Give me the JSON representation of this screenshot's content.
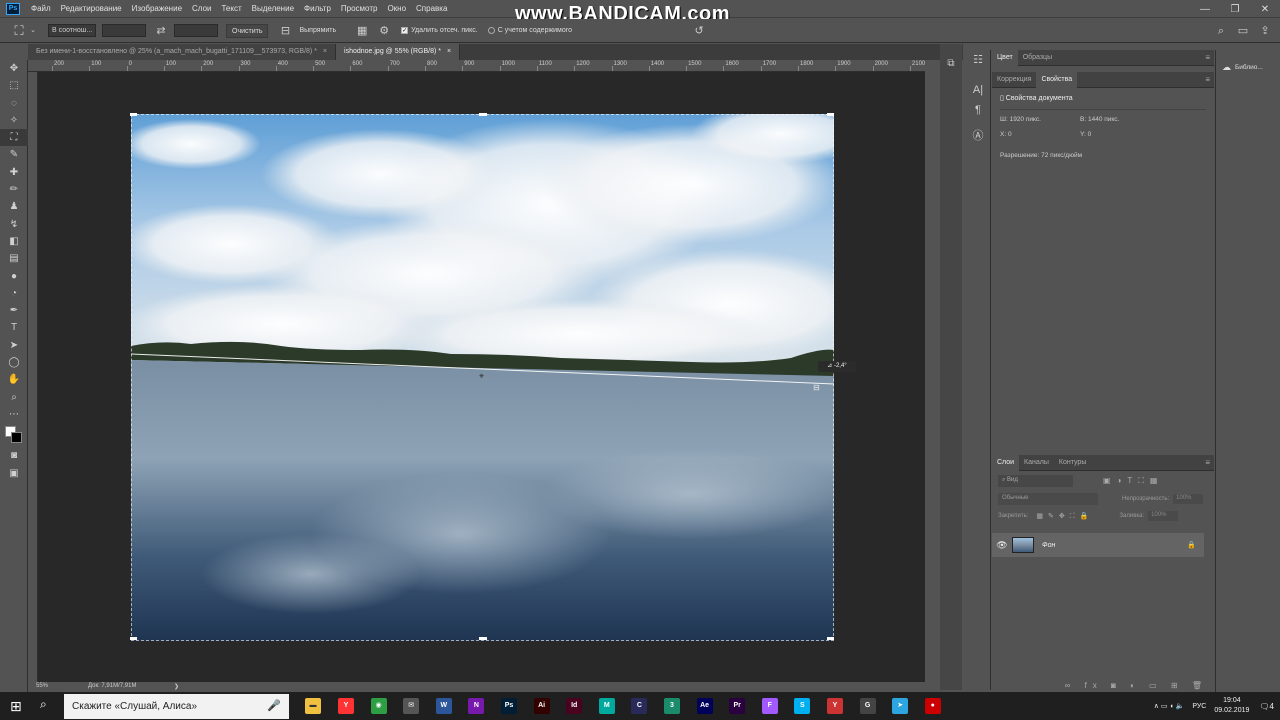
{
  "app": {
    "icon_label": "Ps",
    "menu": [
      "Файл",
      "Редактирование",
      "Изображение",
      "Слои",
      "Текст",
      "Выделение",
      "Фильтр",
      "Просмотр",
      "Окно",
      "Справка"
    ],
    "window_controls": [
      "—",
      "❐",
      "✕"
    ],
    "watermark": "www.BANDICAM.com"
  },
  "options_bar": {
    "ratio_select": "В соотнош...",
    "clear_button": "Очистить",
    "straighten_button": "Выпрямить",
    "delete_cropped_label": "Удалить отсеч. пикс.",
    "content_aware_label": "С учетом содержимого"
  },
  "tabs": [
    {
      "label": "Без имени-1-восстановлено @ 25% (a_mach_mach_bugatti_171109__573973, RGB/8) *",
      "close": "×"
    },
    {
      "label": "ishodnoe.jpg @ 55% (RGB/8) *",
      "close": "×"
    }
  ],
  "ruler_labels": [
    "200",
    "100",
    "0",
    "100",
    "200",
    "300",
    "400",
    "500",
    "600",
    "700",
    "800",
    "900",
    "1000",
    "1100",
    "1200",
    "1300",
    "1400",
    "1500",
    "1600",
    "1700",
    "1800",
    "1900",
    "2000",
    "2100"
  ],
  "canvas": {
    "angle_readout": "-2,4°"
  },
  "status": {
    "zoom": "55%",
    "doc_size": "Док: 7,91M/7,91M",
    "arrow": "❯"
  },
  "color_panel": {
    "tabs": [
      "Цвет",
      "Образцы"
    ]
  },
  "properties_panel": {
    "tabs": [
      "Коррекция",
      "Свойства"
    ],
    "header": "Свойства документа",
    "w_label": "Ш:",
    "w_value": "1920 пикс.",
    "h_label": "В:",
    "h_value": "1440 пикс.",
    "x_label": "X:",
    "x_value": "0",
    "y_label": "Y:",
    "y_value": "0",
    "resolution": "Разрешение: 72 пикс/дюйм"
  },
  "library": {
    "label": "Библио..."
  },
  "layers_panel": {
    "tabs": [
      "Слои",
      "Каналы",
      "Контуры"
    ],
    "kind_label": "Вид",
    "blend_mode": "Обычные",
    "opacity_label": "Непрозрачность:",
    "opacity_value": "100%",
    "lock_label": "Закрепить:",
    "fill_label": "Заливка:",
    "fill_value": "100%",
    "layer_name": "Фон"
  },
  "taskbar": {
    "search_placeholder": "Скажите «Слушай, Алиса»",
    "lang": "РУС",
    "time": "19:04",
    "date": "09.02.2019",
    "notif_count": "4",
    "apps": [
      {
        "label": "Y",
        "color": "#ff3333"
      },
      {
        "label": "◉",
        "color": "#2e9e44"
      },
      {
        "label": "✉",
        "color": "#555555"
      },
      {
        "label": "W",
        "color": "#2b579a"
      },
      {
        "label": "N",
        "color": "#7719aa"
      },
      {
        "label": "Ps",
        "color": "#001e36"
      },
      {
        "label": "Ai",
        "color": "#330000"
      },
      {
        "label": "Id",
        "color": "#49021f"
      },
      {
        "label": "M",
        "color": "#00a99d"
      },
      {
        "label": "C",
        "color": "#2a2a5a"
      },
      {
        "label": "3",
        "color": "#1a8c6c"
      },
      {
        "label": "Ae",
        "color": "#00005b"
      },
      {
        "label": "Pr",
        "color": "#2a0040"
      },
      {
        "label": "F",
        "color": "#a259ff"
      },
      {
        "label": "S",
        "color": "#00aff0"
      },
      {
        "label": "Y",
        "color": "#cc3333"
      },
      {
        "label": "G",
        "color": "#444444"
      },
      {
        "label": "➤",
        "color": "#2ca5e0"
      },
      {
        "label": "●",
        "color": "#cc0000"
      }
    ]
  },
  "colors": {
    "accent": "#31a8ff",
    "canvas_bg": "#282828",
    "panel_bg": "#535353"
  }
}
